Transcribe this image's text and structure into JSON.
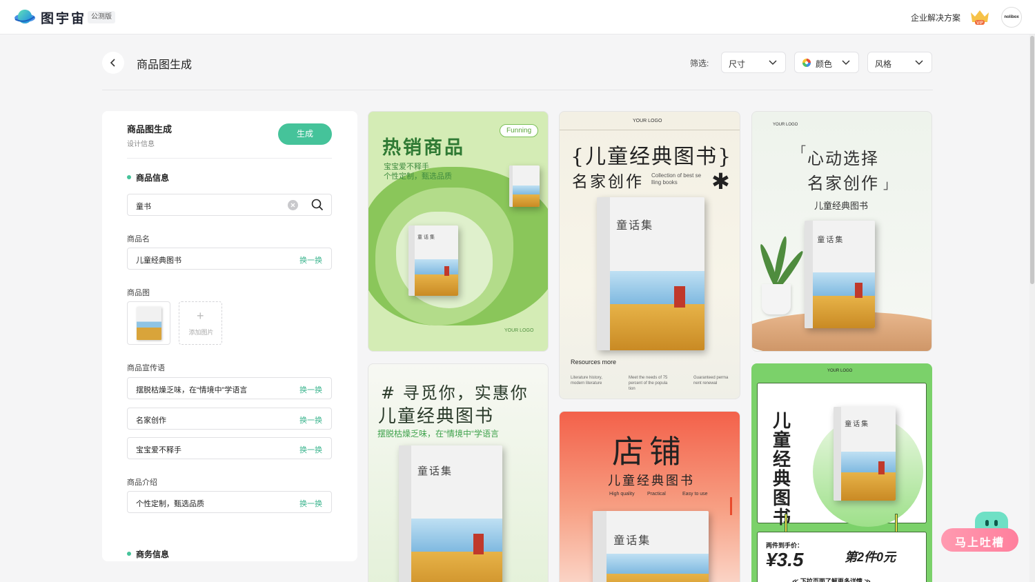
{
  "header": {
    "app_name": "图宇宙",
    "beta_badge": "公测版",
    "enterprise_link": "企业解决方案",
    "vip_label": "VIP",
    "avatar_text": "nolibox"
  },
  "page": {
    "title": "商品图生成",
    "filter_label": "筛选:",
    "filters": [
      {
        "label": "尺寸"
      },
      {
        "label": "颜色"
      },
      {
        "label": "风格"
      }
    ]
  },
  "form": {
    "title": "商品图生成",
    "subtitle": "设计信息",
    "generate_label": "生成",
    "section_product": "商品信息",
    "search_value": "童书",
    "name_label": "商品名",
    "name_value": "儿童经典图书",
    "swap_label": "换一换",
    "image_label": "商品图",
    "add_image_label": "添加图片",
    "slogan_label": "商品宣传语",
    "slogans": [
      "摆脱枯燥乏味，在“情境中”学语言",
      "名家创作",
      "宝宝爱不释手"
    ],
    "intro_label": "商品介绍",
    "intro_value": "个性定制，甄选品质",
    "section_business": "商务信息"
  },
  "cards": {
    "c1": {
      "headline": "热销商品",
      "sub1": "宝宝爱不释手",
      "sub2": "个性定制，甄选品质",
      "bubble": "Funning",
      "logo": "YOUR LOGO"
    },
    "c2": {
      "logo": "YOUR LOGO",
      "headline": "{儿童经典图书}",
      "headline2": "名家创作",
      "en1": "Collection of best se",
      "en2": "lling books",
      "resources": "Resources more",
      "foot1a": "Literature history,",
      "foot1b": "modern literature",
      "foot2a": "Meet the needs of 75",
      "foot2b": "percent of the popula",
      "foot2c": "tion",
      "foot3a": "Guaranteed perma",
      "foot3b": "nent renewal"
    },
    "c3": {
      "logo": "YOUR LOGO",
      "line1": "心动选择",
      "line2": "名家创作",
      "quote_open": "「",
      "quote_close": "」",
      "sub": "儿童经典图书"
    },
    "c4": {
      "headline": "# 寻觅你，实惠你",
      "headline2": "儿童经典图书",
      "sub": "摆脱枯燥乏味，在“情境中“学语言"
    },
    "c5": {
      "headline": "店铺",
      "headline2": "儿童经典图书",
      "tag1": "High quality",
      "tag2": "Practical",
      "tag3": "Easy to use"
    },
    "c6": {
      "logo": "YOUR LOGO",
      "vertical": "儿童经典图书",
      "price_label": "两件到手价：",
      "price": "¥3.5",
      "promo": "第2件0元",
      "footer": "≪ 下拉页面了解更多详情 ≫"
    },
    "book_title": "童话集"
  },
  "feedback": {
    "label": "马上吐槽"
  },
  "colors": {
    "accent": "#45c39a",
    "swap": "#3bb48e"
  }
}
